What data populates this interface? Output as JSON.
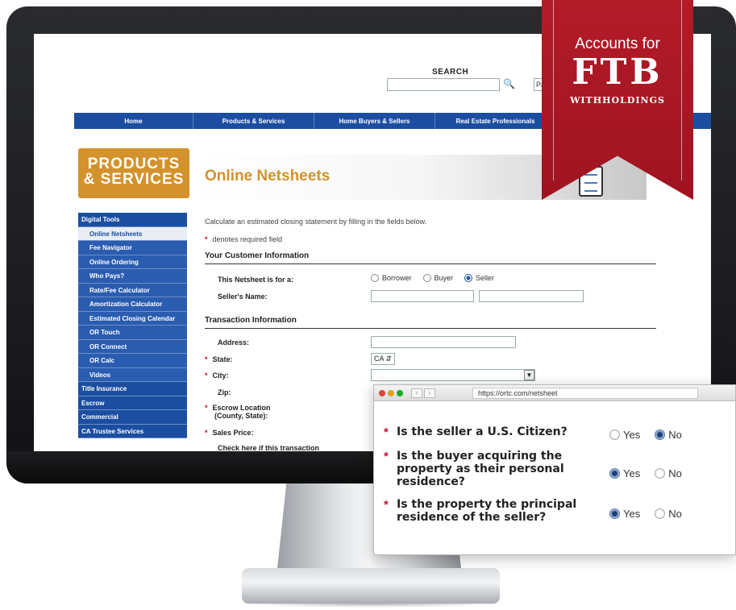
{
  "site": {
    "search_label": "SEARCH",
    "search_select_value": "Pa",
    "nav": [
      "Home",
      "Products & Services",
      "Home Buyers & Sellers",
      "Real Estate Professionals"
    ],
    "badge_line1": "PRODUCTS",
    "badge_line2": "& SERVICES",
    "page_title": "Online Netsheets"
  },
  "sidebar": {
    "items": [
      {
        "label": "Digital Tools",
        "level": "top",
        "active": false
      },
      {
        "label": "Online Netsheets",
        "level": "sub",
        "active": true
      },
      {
        "label": "Fee Navigator",
        "level": "sub",
        "active": false
      },
      {
        "label": "Online Ordering",
        "level": "sub",
        "active": false
      },
      {
        "label": "Who Pays?",
        "level": "sub",
        "active": false
      },
      {
        "label": "Rate/Fee Calculator",
        "level": "sub",
        "active": false
      },
      {
        "label": "Amortization Calculator",
        "level": "sub",
        "active": false
      },
      {
        "label": "Estimated Closing Calendar",
        "level": "sub",
        "active": false
      },
      {
        "label": "OR Touch",
        "level": "sub",
        "active": false
      },
      {
        "label": "OR Connect",
        "level": "sub",
        "active": false
      },
      {
        "label": "OR Calc",
        "level": "sub",
        "active": false
      },
      {
        "label": "Videos",
        "level": "sub",
        "active": false
      },
      {
        "label": "Title Insurance",
        "level": "top",
        "active": false
      },
      {
        "label": "Escrow",
        "level": "top",
        "active": false
      },
      {
        "label": "Commercial",
        "level": "top",
        "active": false
      },
      {
        "label": "CA Trustee Services",
        "level": "top",
        "active": false
      }
    ]
  },
  "form": {
    "intro": "Calculate an estimated closing statement by filling in the fields below.",
    "required_marker": "*",
    "required_note": "denotes required field",
    "section_customer": "Your Customer Information",
    "netsheet_for_label": "This Netsheet is for a:",
    "netsheet_for_options": [
      "Borrower",
      "Buyer",
      "Seller"
    ],
    "netsheet_for_selected": "Seller",
    "sellers_name_label": "Seller's Name:",
    "section_transaction": "Transaction Information",
    "address_label": "Address:",
    "state_label": "State:",
    "state_value": "CA",
    "city_label": "City:",
    "zip_label": "Zip:",
    "escrow_label_1": "Escrow Location",
    "escrow_label_2": "(County, State):",
    "sales_price_label": "Sales Price:",
    "check_here_label": "Check here if this transaction"
  },
  "popup": {
    "url": "https://ortc.com/netsheet",
    "yes": "Yes",
    "no": "No",
    "questions": [
      {
        "text": "Is the seller a U.S. Citizen?",
        "answer": "No"
      },
      {
        "text": "Is the buyer acquiring the property as their personal residence?",
        "answer": "Yes"
      },
      {
        "text": "Is the property the principal residence of the seller?",
        "answer": "Yes"
      }
    ]
  },
  "ribbon": {
    "line1": "Accounts for",
    "line2": "FTB",
    "line3": "WITHHOLDINGS"
  },
  "colors": {
    "nav_blue": "#1b4ea0",
    "accent_orange": "#d4922d",
    "ribbon_red": "#b31b28",
    "required_red": "#c8102e"
  }
}
